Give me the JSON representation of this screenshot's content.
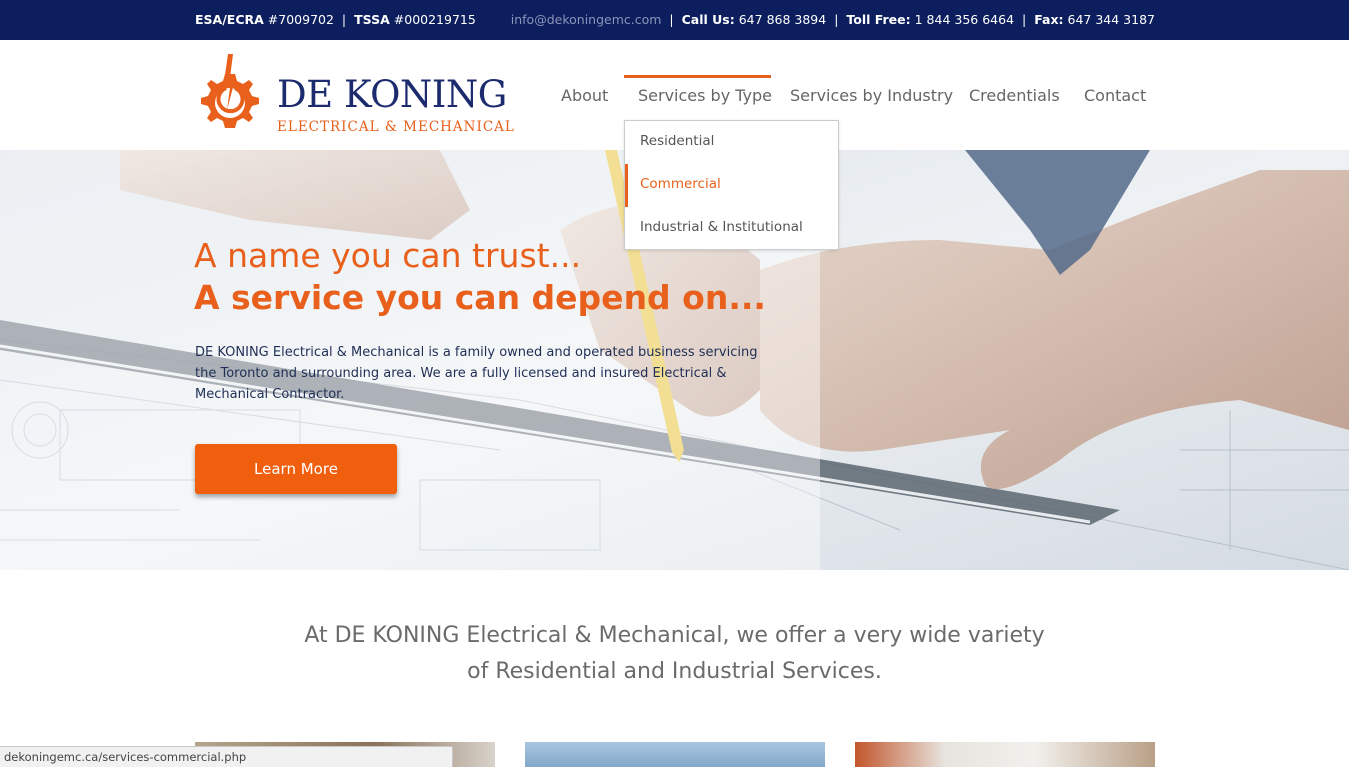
{
  "topbar": {
    "esa_label": "ESA/ECRA",
    "esa_value": "#7009702",
    "tssa_label": "TSSA",
    "tssa_value": "#000219715",
    "email": "info@dekoningemc.com",
    "call_label": "Call Us:",
    "call_value": "647 868 3894",
    "tollfree_label": "Toll Free:",
    "tollfree_value": "1 844 356 6464",
    "fax_label": "Fax:",
    "fax_value": "647 344 3187",
    "separator": "|"
  },
  "logo": {
    "name_part1": "De",
    "name_part2": "Koning",
    "subtitle": "Electrical & Mechanical",
    "color_primary": "#1b2b6e",
    "color_accent": "#e8601c",
    "icon": "gear-lightning-icon"
  },
  "nav": {
    "items": [
      {
        "label": "About"
      },
      {
        "label": "Services by Type"
      },
      {
        "label": "Services by Industry"
      },
      {
        "label": "Credentials"
      },
      {
        "label": "Contact"
      }
    ],
    "active_index": 1,
    "dropdown": {
      "items": [
        {
          "label": "Residential"
        },
        {
          "label": "Commercial"
        },
        {
          "label": "Industrial & Institutional"
        }
      ],
      "highlighted_index": 1
    }
  },
  "hero": {
    "heading1": "A name you can trust...",
    "heading2": "A service you can depend on...",
    "description": "DE KONING Electrical & Mechanical is a family owned and operated business servicing the Toronto and surrounding area. We are a fully licensed and insured Electrical & Mechanical Contractor.",
    "button_label": "Learn More",
    "accent_color": "#e8601c",
    "button_color": "#f05f0d"
  },
  "intro": {
    "line1": "At DE KONING Electrical & Mechanical, we offer a very wide variety",
    "line2": "of Residential and Industrial Services."
  },
  "statusbar": {
    "url": "dekoningemc.ca/services-commercial.php"
  },
  "colors": {
    "topbar_bg": "#0d1e5e",
    "nav_text": "#666666"
  }
}
